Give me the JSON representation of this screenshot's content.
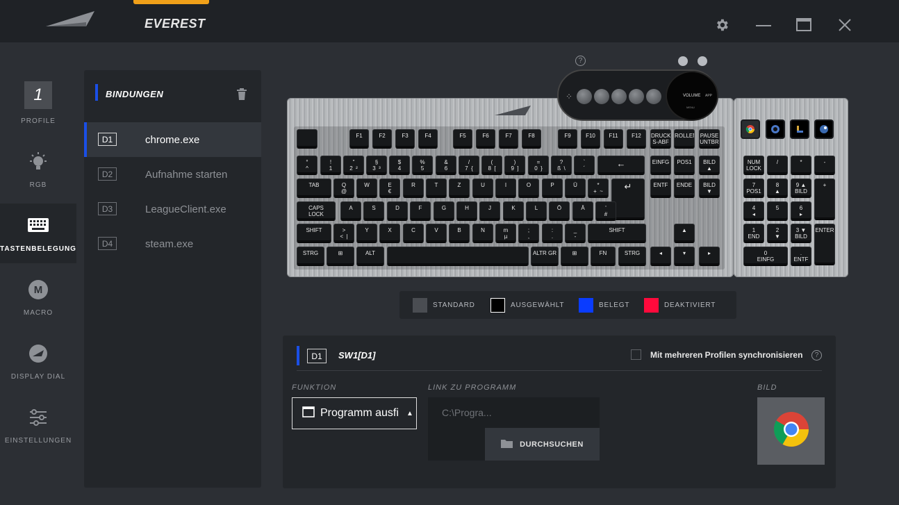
{
  "app": {
    "title": "EVEREST"
  },
  "nav": {
    "profile": {
      "number": "1",
      "label": "PROFILE"
    },
    "rgb": "RGB",
    "keymap": "TASTENBELEGUNG",
    "macro": {
      "letter": "M",
      "label": "MACRO"
    },
    "display_dial": "DISPLAY DIAL",
    "settings": "EINSTELLUNGEN"
  },
  "bindings": {
    "title": "BINDUNGEN",
    "items": [
      {
        "code": "D1",
        "name": "chrome.exe"
      },
      {
        "code": "D2",
        "name": "Aufnahme starten"
      },
      {
        "code": "D3",
        "name": "LeagueClient.exe"
      },
      {
        "code": "D4",
        "name": "steam.exe"
      }
    ]
  },
  "dial": {
    "screen_label": "VOLUME",
    "app_label": "APP",
    "menu_label": "MENU",
    "help": "?"
  },
  "keyboard": {
    "row0": [
      "F1",
      "F2",
      "F3",
      "F4",
      "F5",
      "F6",
      "F7",
      "F8",
      "F9",
      "F10",
      "F11",
      "F12",
      "DRUCK\nS-ABF",
      "ROLLEN",
      "PAUSE\nUNTBR"
    ],
    "row1": [
      "°\n^",
      "!\n1",
      "\"\n2  ²",
      "§\n3  ³",
      "$\n4",
      "%\n5",
      "&\n6",
      "/\n7  {",
      "(\n8  [",
      ")\n9  ]",
      "=\n0  }",
      "?\nß  \\",
      "`\n´",
      "←",
      "EINFG",
      "POS1",
      "BILD\n▲"
    ],
    "row2": [
      "TAB",
      "Q\n@",
      "W",
      "E\n€",
      "R",
      "T",
      "Z",
      "U",
      "I",
      "O",
      "P",
      "Ü",
      "*\n+  ~",
      "↵",
      "ENTF",
      "ENDE",
      "BILD\n▼"
    ],
    "row3": [
      "CAPS\nLOCK",
      "A",
      "S",
      "D",
      "F",
      "G",
      "H",
      "J",
      "K",
      "L",
      "Ö",
      "Ä",
      "'\n#"
    ],
    "row4": [
      "SHIFT",
      ">\n<  |",
      "Y",
      "X",
      "C",
      "V",
      "B",
      "N",
      "m\nµ",
      ";\n,",
      ":\n.",
      "_\n-",
      "SHIFT",
      "▲"
    ],
    "row5": [
      "STRG",
      "⊞",
      "ALT",
      "",
      "ALTR GR",
      "⊞",
      "FN",
      "STRG",
      "◂",
      "▾",
      "▸"
    ],
    "numpad": [
      "NUM\nLOCK",
      "/",
      "*",
      "-",
      "7\nPOS1",
      "8\n▲",
      "9 ▲\nBILD",
      "+",
      "4\n◂",
      "5",
      "6\n▸",
      "1\nEND",
      "2\n▼",
      "3 ▼\nBILD",
      "ENTER",
      "0\nEINFG",
      ".\nENTF"
    ]
  },
  "legend": [
    {
      "label": "STANDARD",
      "color": "#4a4d52"
    },
    {
      "label": "AUSGEWÄHLT",
      "color": "#000000"
    },
    {
      "label": "BELEGT",
      "color": "#0a3cff"
    },
    {
      "label": "DEAKTIVIERT",
      "color": "#ff0a3c"
    }
  ],
  "detail": {
    "code": "D1",
    "title": "SW1[D1]",
    "sync_label": "Mit mehreren Profilen synchronisieren",
    "help": "?",
    "function_label": "FUNKTION",
    "function_value": "Programm ausfi",
    "link_label": "LINK ZU PROGRAMM",
    "link_value": "C:\\Progra...",
    "browse_label": "DURCHSUCHEN",
    "image_label": "BILD"
  }
}
